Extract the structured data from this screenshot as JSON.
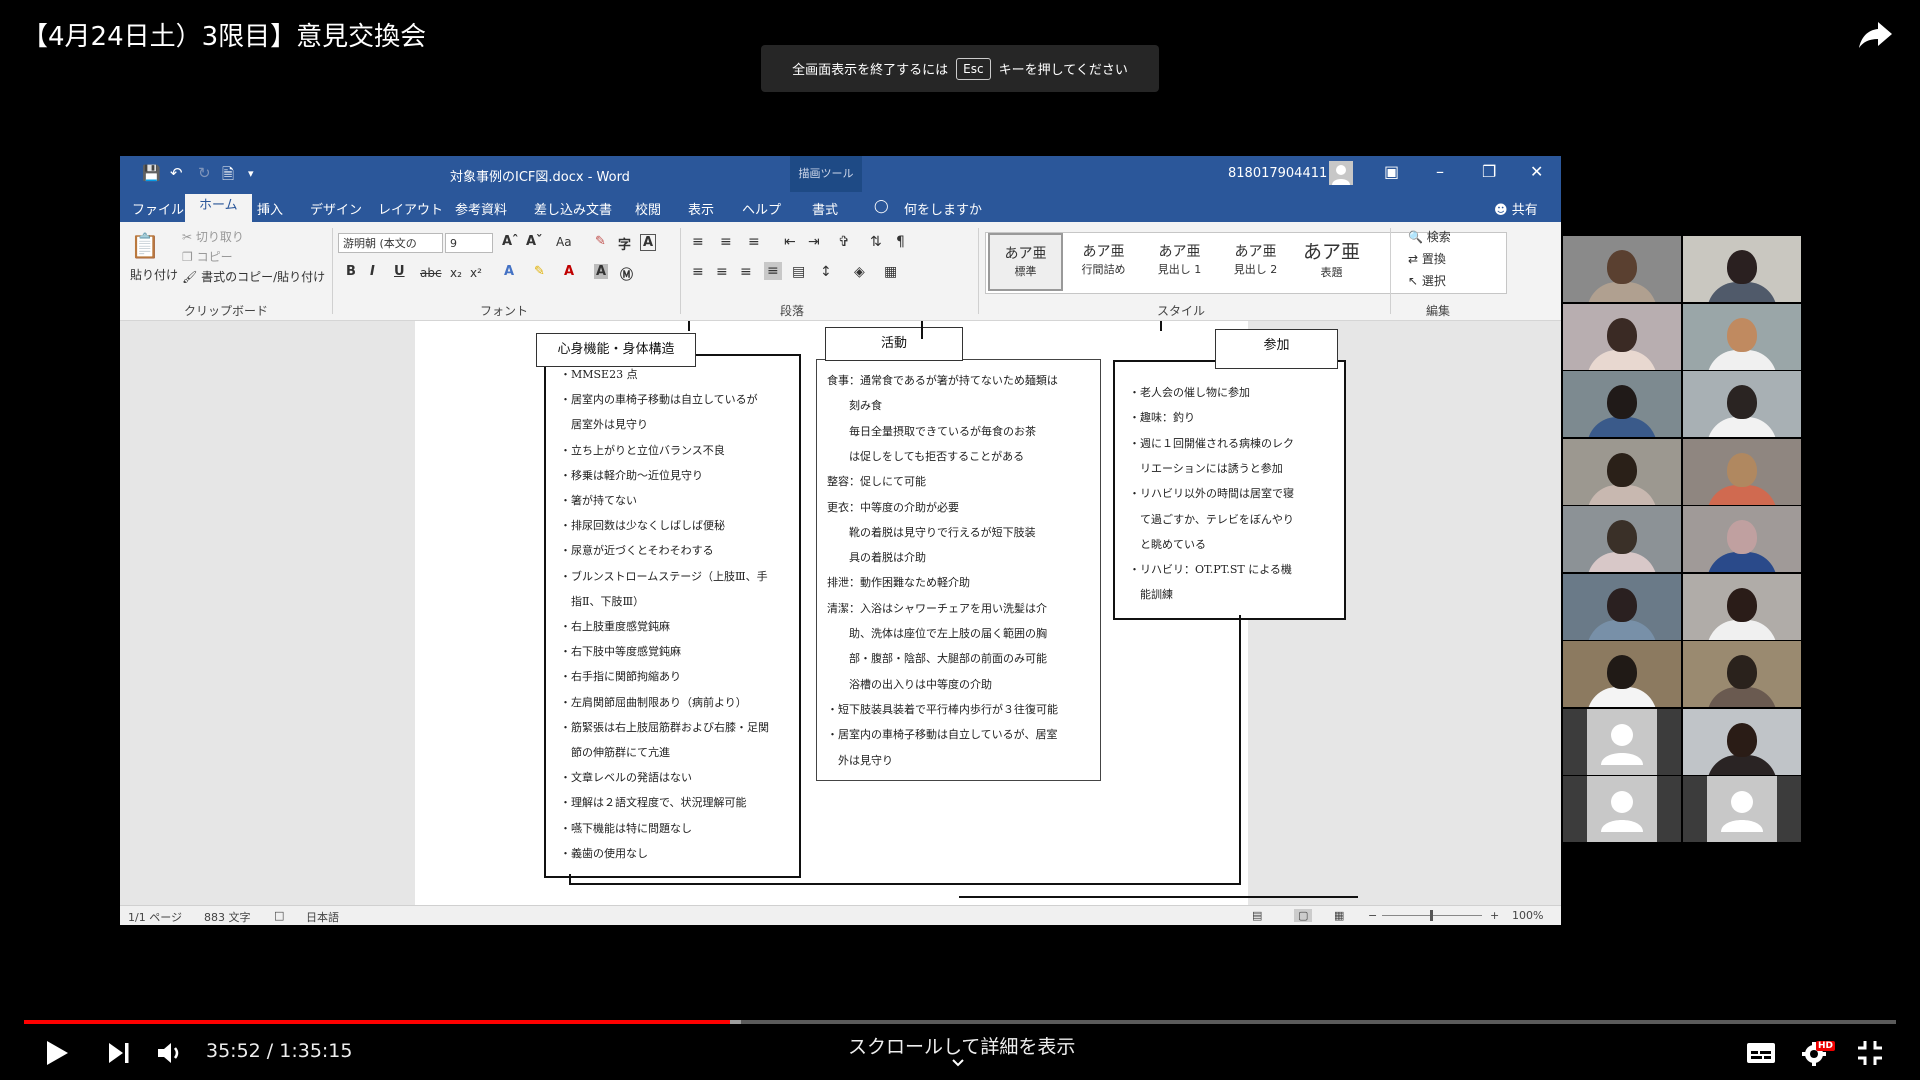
{
  "video": {
    "title": "【4月24日土）3限目】意見交換会",
    "fullscreen_toast": {
      "prefix": "全画面表示を終了するには",
      "key": "Esc",
      "suffix": "キーを押してください"
    },
    "time": "35:52 / 1:35:15",
    "scroll_hint": "スクロールして詳細を表示",
    "progress_played_fraction": 0.377,
    "progress_loaded_fraction": 0.383,
    "hd_badge": "HD",
    "icons": [
      "share-icon",
      "play-icon",
      "next-icon",
      "volume-icon",
      "subtitles-icon",
      "settings-icon",
      "exit-fullscreen-icon",
      "chevron-down-icon"
    ]
  },
  "word": {
    "doc_title": "対象事例のICF図.docx  -  Word",
    "tools_tab": "描画ツール",
    "account": "818017904411",
    "tabs": [
      "ファイル",
      "ホーム",
      "挿入",
      "デザイン",
      "レイアウト",
      "参考資料",
      "差し込み文書",
      "校閲",
      "表示",
      "ヘルプ",
      "書式"
    ],
    "tell_me": "何をしますか",
    "share": "共有",
    "clipboard": {
      "paste": "貼り付け",
      "cut": "切り取り",
      "copy": "コピー",
      "format_painter": "書式のコピー/貼り付け",
      "label": "クリップボード"
    },
    "font": {
      "name": "游明朝 (本文の",
      "size": "9",
      "label": "フォント",
      "aa": "Aa"
    },
    "paragraph_label": "段落",
    "styles": {
      "label": "スタイル",
      "items": [
        {
          "sample": "あア亜",
          "name": "標準"
        },
        {
          "sample": "あア亜",
          "name": "行間詰め"
        },
        {
          "sample": "あア亜",
          "name": "見出し 1"
        },
        {
          "sample": "あア亜",
          "name": "見出し 2"
        },
        {
          "sample": "あア亜",
          "name": "表題"
        }
      ]
    },
    "editing": {
      "find": "検索",
      "replace": "置換",
      "select": "選択",
      "label": "編集"
    },
    "status": {
      "page": "1/1 ページ",
      "words": "883 文字",
      "lang": "日本語",
      "zoom": "100%"
    }
  },
  "document": {
    "box1": {
      "header": "心身機能・身体構造",
      "lines": [
        "・MMSE23 点",
        "・居室内の車椅子移動は自立しているが",
        "　居室外は見守り",
        "・立ち上がりと立位バランス不良",
        "・移乗は軽介助～近位見守り",
        "・箸が持てない",
        "・排尿回数は少なくしばしば便秘",
        "・尿意が近づくとそわそわする",
        "・ブルンストロームステージ（上肢Ⅲ、手",
        "　指Ⅱ、下肢Ⅲ）",
        "・右上肢重度感覚鈍麻",
        "・右下肢中等度感覚鈍麻",
        "・右手指に関節拘縮あり",
        "・左肩関節屈曲制限あり（病前より）",
        "・筋緊張は右上肢屈筋群および右膝・足関",
        "　節の伸筋群にて亢進",
        "・文章レベルの発語はない",
        "・理解は２語文程度で、状況理解可能",
        "・嚥下機能は特に問題なし",
        "・義歯の使用なし"
      ]
    },
    "box2": {
      "header": "活動",
      "lines": [
        "食事：通常食であるが箸が持てないため麺類は",
        "　　刻み食",
        "　　毎日全量摂取できているが毎食のお茶",
        "　　は促しをしても拒否することがある",
        "整容：促しにて可能",
        "更衣：中等度の介助が必要",
        "　　靴の着脱は見守りで行えるが短下肢装",
        "　　具の着脱は介助",
        "排泄：動作困難なため軽介助",
        "清潔：入浴はシャワーチェアを用い洗髪は介",
        "　　助、洗体は座位で左上肢の届く範囲の胸",
        "　　部・腹部・陰部、大腿部の前面のみ可能",
        "　　浴槽の出入りは中等度の介助",
        "・短下肢装具装着で平行棒内歩行が３往復可能",
        "・居室内の車椅子移動は自立しているが、居室",
        "　外は見守り"
      ]
    },
    "box3": {
      "header": "参加",
      "lines": [
        "・老人会の催し物に参加",
        "・趣味：釣り",
        "・週に１回開催される病棟のレク",
        "　リエーションには誘うと参加",
        "・リハビリ以外の時間は居室で寝",
        "　て過ごすか、テレビをぼんやり",
        "　と眺めている",
        "・リハビリ：OT.PT.ST による機",
        "　能訓練"
      ]
    }
  }
}
